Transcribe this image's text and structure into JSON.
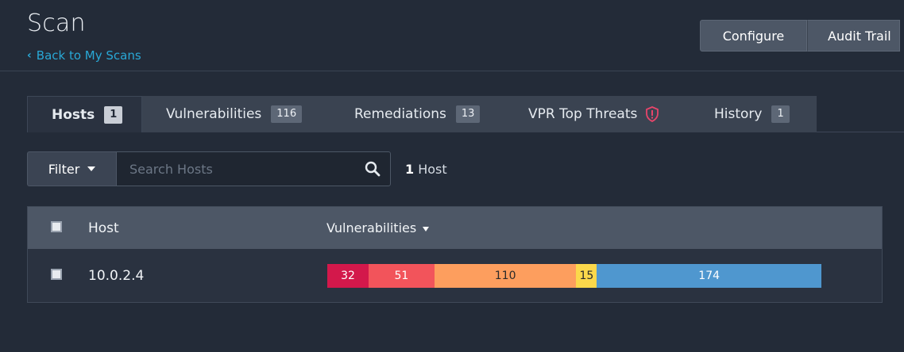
{
  "header": {
    "title": "Scan",
    "back_label": "Back to My Scans",
    "buttons": {
      "configure": "Configure",
      "audit_trail": "Audit Trail"
    }
  },
  "tabs": [
    {
      "label": "Hosts",
      "badge": "1",
      "active": true
    },
    {
      "label": "Vulnerabilities",
      "badge": "116"
    },
    {
      "label": "Remediations",
      "badge": "13"
    },
    {
      "label": "VPR Top Threats",
      "icon": "shield-alert-icon"
    },
    {
      "label": "History",
      "badge": "1"
    }
  ],
  "filter": {
    "label": "Filter",
    "search_placeholder": "Search Hosts",
    "count_number": "1",
    "count_label": "Host"
  },
  "table": {
    "headers": {
      "host": "Host",
      "vulnerabilities": "Vulnerabilities"
    },
    "rows": [
      {
        "host": "10.0.2.4",
        "severity": {
          "critical": 32,
          "high": 51,
          "medium": 110,
          "low": 15,
          "info": 174
        },
        "labels": {
          "critical": "32",
          "high": "51",
          "medium": "110",
          "low": "15",
          "info": "174"
        }
      }
    ]
  },
  "colors": {
    "critical": "#d3184b",
    "high": "#f2545b",
    "medium": "#fd9e5e",
    "low": "#fbd84b",
    "info": "#4f97cf",
    "link": "#29a8d6",
    "background": "#232b38"
  }
}
